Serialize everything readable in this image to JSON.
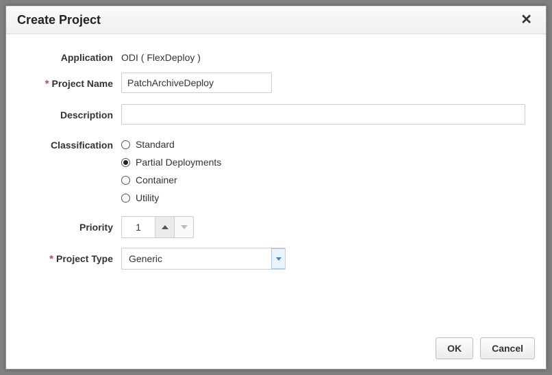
{
  "dialog": {
    "title": "Create Project",
    "close": "✕"
  },
  "labels": {
    "application": "Application",
    "projectName": "Project Name",
    "description": "Description",
    "classification": "Classification",
    "priority": "Priority",
    "projectType": "Project Type"
  },
  "values": {
    "application": "ODI ( FlexDeploy )",
    "projectName": "PatchArchiveDeploy",
    "description": "",
    "priority": "1",
    "projectType": "Generic"
  },
  "classification": {
    "options": {
      "standard": "Standard",
      "partial": "Partial Deployments",
      "container": "Container",
      "utility": "Utility"
    },
    "selected": "partial"
  },
  "buttons": {
    "ok": "OK",
    "cancel": "Cancel"
  },
  "required_marker": "*"
}
